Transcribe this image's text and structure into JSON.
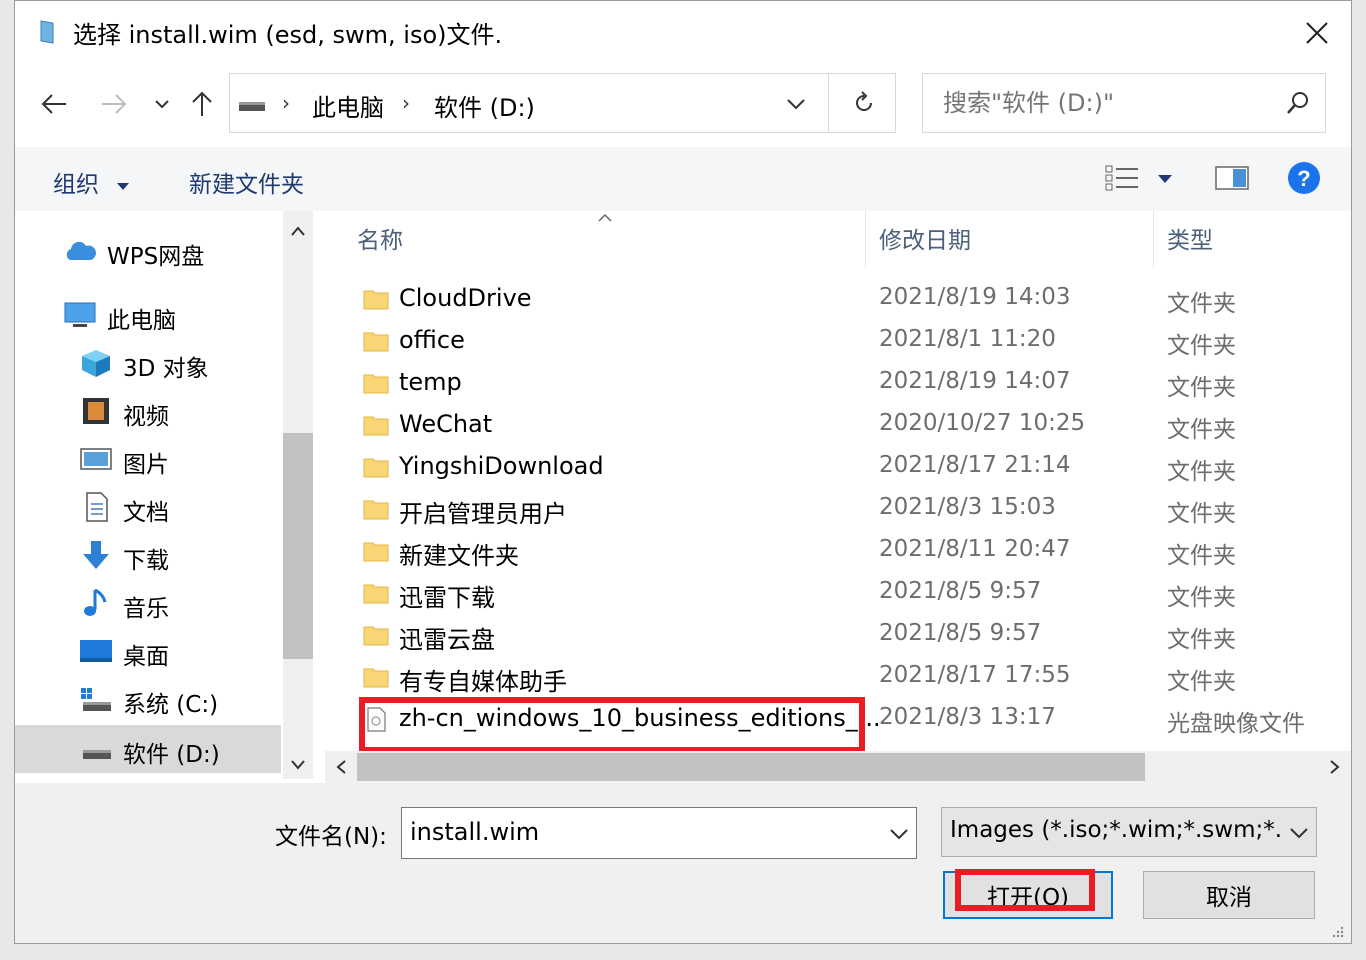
{
  "window": {
    "title": "选择 install.wim (esd, swm, iso)文件.",
    "close_icon": "close-icon"
  },
  "nav": {
    "back_icon": "arrow-left-icon",
    "forward_icon": "arrow-right-icon",
    "recent_icon": "chevron-down-icon",
    "up_icon": "arrow-up-icon",
    "breadcrumb": [
      "此电脑",
      "软件 (D:)"
    ],
    "refresh_icon": "refresh-icon"
  },
  "search": {
    "placeholder": "搜索\"软件 (D:)\"",
    "icon": "search-icon"
  },
  "toolbar": {
    "organize_label": "组织",
    "new_folder_label": "新建文件夹",
    "view_icon": "details-view-icon",
    "preview_icon": "preview-pane-icon",
    "help_icon": "help-icon",
    "help_color": "#1a73e8"
  },
  "sidebar": {
    "items": [
      {
        "label": "WPS网盘",
        "icon": "cloud-icon"
      },
      {
        "label": "此电脑",
        "icon": "computer-icon"
      },
      {
        "label": "3D 对象",
        "icon": "cube-icon"
      },
      {
        "label": "视频",
        "icon": "video-icon"
      },
      {
        "label": "图片",
        "icon": "picture-icon"
      },
      {
        "label": "文档",
        "icon": "document-icon"
      },
      {
        "label": "下载",
        "icon": "download-icon"
      },
      {
        "label": "音乐",
        "icon": "music-icon"
      },
      {
        "label": "桌面",
        "icon": "desktop-icon"
      },
      {
        "label": "系统 (C:)",
        "icon": "system-drive-icon"
      },
      {
        "label": "软件 (D:)",
        "icon": "drive-icon"
      }
    ],
    "selected": "软件 (D:)"
  },
  "files": {
    "columns": [
      "名称",
      "修改日期",
      "类型"
    ],
    "rows": [
      {
        "name": "CloudDrive",
        "date": "2021/8/19 14:03",
        "type": "文件夹"
      },
      {
        "name": "office",
        "date": "2021/8/1 11:20",
        "type": "文件夹"
      },
      {
        "name": "temp",
        "date": "2021/8/19 14:07",
        "type": "文件夹"
      },
      {
        "name": "WeChat",
        "date": "2020/10/27 10:25",
        "type": "文件夹"
      },
      {
        "name": "YingshiDownload",
        "date": "2021/8/17 21:14",
        "type": "文件夹"
      },
      {
        "name": "开启管理员用户",
        "date": "2021/8/3 15:03",
        "type": "文件夹"
      },
      {
        "name": "新建文件夹",
        "date": "2021/8/11 20:47",
        "type": "文件夹"
      },
      {
        "name": "迅雷下载",
        "date": "2021/8/5 9:57",
        "type": "文件夹"
      },
      {
        "name": "迅雷云盘",
        "date": "2021/8/5 9:57",
        "type": "文件夹"
      },
      {
        "name": "有专自媒体助手",
        "date": "2021/8/17 17:55",
        "type": "文件夹"
      },
      {
        "name": "zh-cn_windows_10_business_editions_...",
        "date": "2021/8/3 13:17",
        "type": "光盘映像文件"
      }
    ],
    "highlight_color": "#ea1c24"
  },
  "footer": {
    "filename_label": "文件名(N):",
    "filename_value": "install.wim",
    "filetype_value": "Images (*.iso;*.wim;*.swm;*.e",
    "open_label": "打开(O)",
    "cancel_label": "取消"
  }
}
